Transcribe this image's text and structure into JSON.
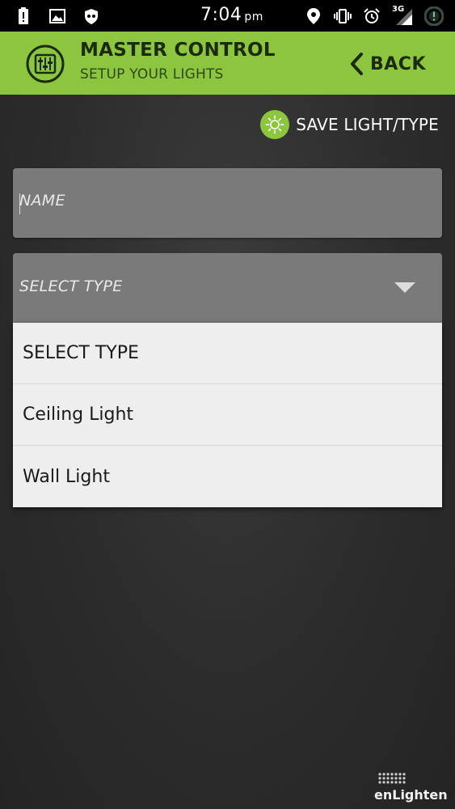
{
  "status_bar": {
    "time": "7:04",
    "ampm": "pm",
    "network": "3G",
    "icons": [
      "alert-icon",
      "image-icon",
      "incognito-icon",
      "location-icon",
      "vibrate-icon",
      "alarm-icon",
      "signal-icon",
      "notification-icon"
    ]
  },
  "header": {
    "title": "MASTER CONTROL",
    "subtitle": "SETUP YOUR LIGHTS",
    "back_label": "BACK",
    "accent_color": "#8cc63f"
  },
  "actions": {
    "save_label": "SAVE LIGHT/TYPE"
  },
  "form": {
    "name_placeholder": "NAME",
    "type_value": "SELECT TYPE",
    "type_options": [
      "SELECT TYPE",
      "Ceiling Light",
      "Wall Light"
    ]
  },
  "brand": {
    "name": "enLighten"
  }
}
